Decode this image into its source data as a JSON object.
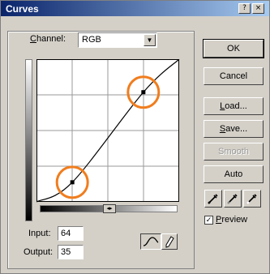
{
  "window": {
    "title": "Curves"
  },
  "title_buttons": [
    "?",
    "×"
  ],
  "channel": {
    "label": "Channel:",
    "label_accel": "C",
    "label_rest": "hannel:",
    "value": "RGB"
  },
  "curve": {
    "points": [
      {
        "input": 64,
        "output": 35
      },
      {
        "input": 191,
        "output": 196
      }
    ],
    "selected_index": 0
  },
  "input": {
    "label": "Input:",
    "value": "64"
  },
  "output": {
    "label": "Output:",
    "value": "35"
  },
  "buttons": {
    "ok": "OK",
    "cancel": "Cancel",
    "load_accel": "L",
    "load_rest": "oad...",
    "save_accel": "S",
    "save_rest": "ave...",
    "smooth": "Smooth",
    "auto": "Auto"
  },
  "preview": {
    "label_accel": "P",
    "label_rest": "review",
    "checked": true
  },
  "colors": {
    "highlight_circle": "#f07d1e",
    "curve": "#000000"
  }
}
